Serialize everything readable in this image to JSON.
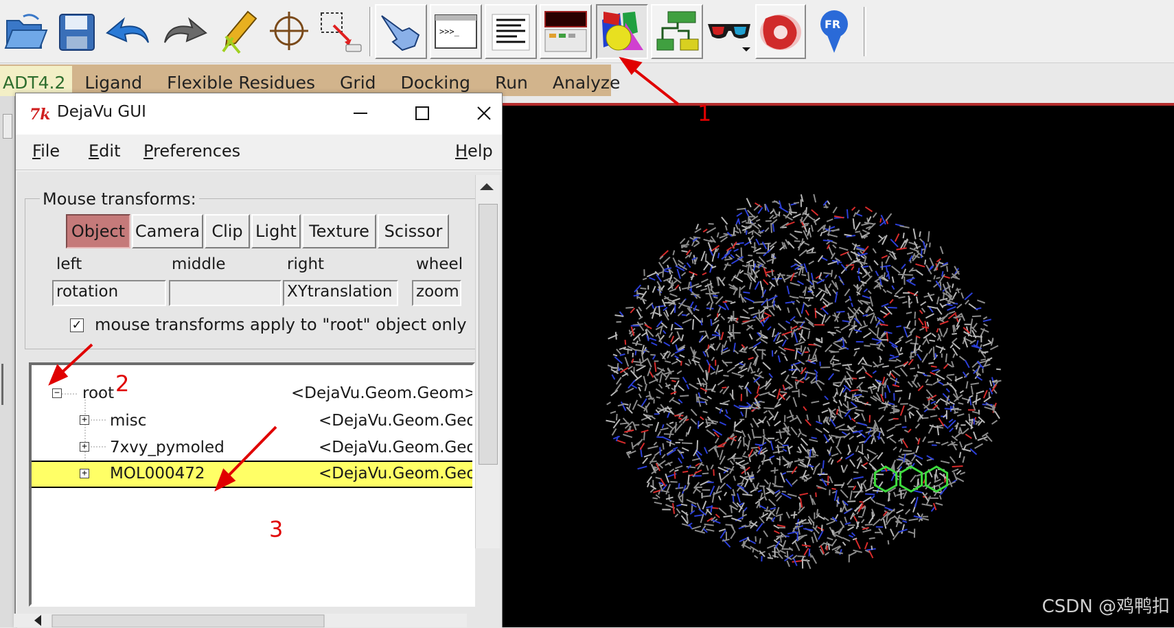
{
  "toolbar": {
    "buttons": [
      {
        "name": "open-folder-icon"
      },
      {
        "name": "save-icon"
      },
      {
        "name": "undo-icon"
      },
      {
        "name": "redo-icon"
      },
      {
        "name": "pencil-scissors-icon"
      },
      {
        "name": "crosshair-icon"
      },
      {
        "name": "selection-icon"
      },
      {
        "name": "pointer-hand-icon"
      },
      {
        "name": "python-shell-icon"
      },
      {
        "name": "text-lines-icon"
      },
      {
        "name": "dashboard-icon"
      },
      {
        "name": "dejavu-gui-icon"
      },
      {
        "name": "network-editor-icon"
      },
      {
        "name": "stereo-glasses-icon"
      },
      {
        "name": "red-shape-icon"
      },
      {
        "name": "fr-icon"
      }
    ],
    "colors": {
      "highlight_button": "#d9d9d9"
    }
  },
  "adt_menu": {
    "items": [
      "ADT4.2",
      "Ligand",
      "Flexible Residues",
      "Grid",
      "Docking",
      "Run",
      "Analyze"
    ],
    "colors": {
      "bar": "#d2b48c",
      "active": "#f3efc6"
    }
  },
  "dejavu": {
    "title": "DejaVu GUI",
    "controls": {
      "minimize": "—",
      "maximize": "☐",
      "close": "✕"
    },
    "menu": {
      "file_prefix": "",
      "file_ul": "F",
      "file_rest": "ile",
      "edit_ul": "E",
      "edit_rest": "dit",
      "prefs_ul": "P",
      "prefs_rest": "references",
      "help_ul": "H",
      "help_rest": "elp"
    },
    "mouse_transforms": {
      "legend": "Mouse transforms:",
      "tabs": [
        "Object",
        "Camera",
        "Clip",
        "Light",
        "Texture",
        "Scissor"
      ],
      "active_tab": "Object",
      "columns": [
        "left",
        "middle",
        "right",
        "wheel"
      ],
      "values": [
        "rotation",
        "",
        "XYtranslation",
        "zoom"
      ],
      "checkbox_checked": true,
      "checkbox_mark": "✓",
      "checkbox_label": "mouse transforms apply to \"root\" object only"
    },
    "tree": {
      "rows": [
        {
          "toggle": "−",
          "name": "root",
          "type": "<DejaVu.Geom.Geom>"
        },
        {
          "toggle": "+",
          "name": "misc",
          "type": "<DejaVu.Geom.Geo"
        },
        {
          "toggle": "+",
          "name": "7xvy_pymoled",
          "type": "<DejaVu.Geom.Geo"
        },
        {
          "toggle": "+",
          "name": "MOL000472",
          "type": "<DejaVu.Geom.Geo",
          "selected": true
        }
      ],
      "colors": {
        "selected": "#ffff66"
      }
    }
  },
  "viewer": {
    "watermark": "CSDN @鸡鸭扣",
    "colors": {
      "background": "#000000",
      "carbon": "#8c8c8c",
      "nitrogen": "#2b3fd9",
      "oxygen": "#d92b2b",
      "ligand": "#3ddc3d"
    }
  },
  "annotations": {
    "labels": [
      "1",
      "2",
      "3"
    ],
    "color": "#e00000"
  }
}
